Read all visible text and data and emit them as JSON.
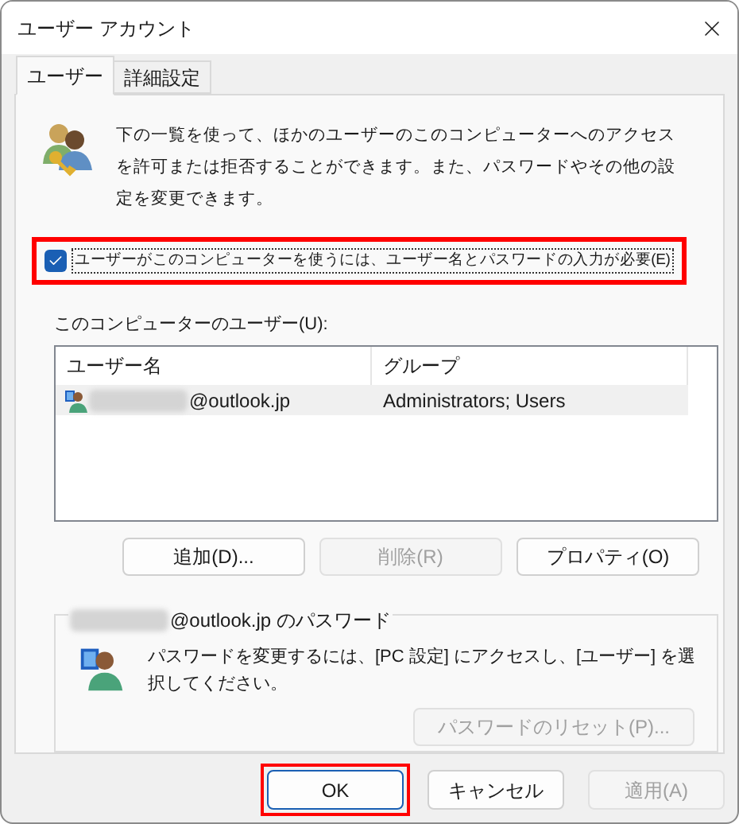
{
  "window": {
    "title": "ユーザー アカウント"
  },
  "tabs": [
    {
      "label": "ユーザー",
      "selected": true
    },
    {
      "label": "詳細設定",
      "selected": false
    }
  ],
  "intro": "下の一覧を使って、ほかのユーザーのこのコンピューターへのアクセスを許可または拒否することができます。また、パスワードやその他の設定を変更できます。",
  "require_password": {
    "label": "ユーザーがこのコンピューターを使うには、ユーザー名とパスワードの入力が必要(E)",
    "checked": true,
    "highlighted": true
  },
  "users": {
    "label": "このコンピューターのユーザー(U):",
    "columns": [
      "ユーザー名",
      "グループ"
    ],
    "rows": [
      {
        "user_name": "@outlook.jp",
        "name_blurred": true,
        "group": "Administrators; Users",
        "selected": true
      }
    ]
  },
  "user_buttons": [
    {
      "label": "追加(D)...",
      "disabled": false
    },
    {
      "label": "削除(R)",
      "disabled": true
    },
    {
      "label": "プロパティ(O)",
      "disabled": false
    }
  ],
  "password_group": {
    "title": "@outlook.jp のパスワード",
    "title_blurred": true,
    "text": "パスワードを変更するには、[PC 設定] にアクセスし、[ユーザー] を選択してください。",
    "button": {
      "label": "パスワードのリセット(P)...",
      "disabled": true
    }
  },
  "dialog_buttons": [
    {
      "label": "OK",
      "disabled": false,
      "default": true,
      "highlighted": true
    },
    {
      "label": "キャンセル",
      "disabled": false,
      "default": false,
      "highlighted": false
    },
    {
      "label": "適用(A)",
      "disabled": true,
      "default": false,
      "highlighted": false
    }
  ]
}
